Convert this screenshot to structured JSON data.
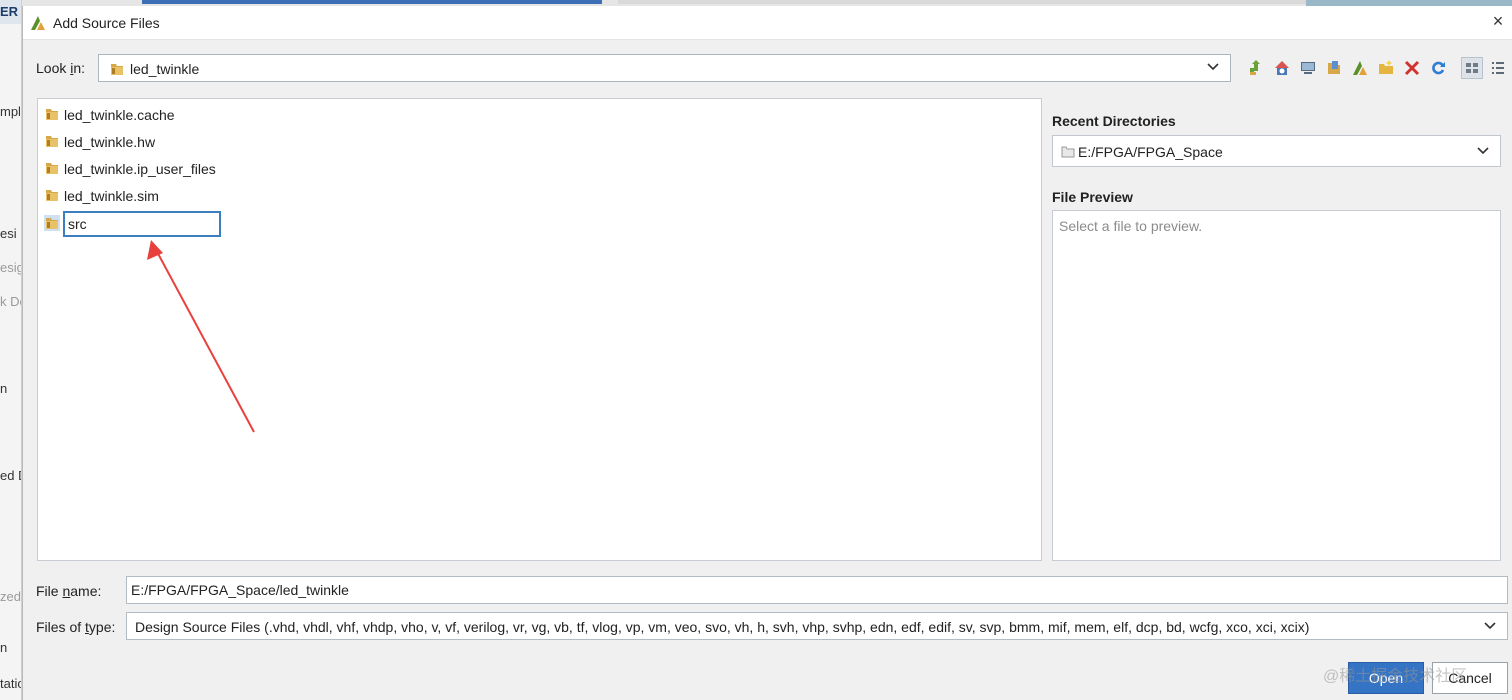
{
  "background_app": {
    "fragments": [
      "ER",
      "mpla",
      "esi",
      "esig",
      "k De",
      "n",
      "ed D",
      "zed",
      "n",
      "tatio"
    ]
  },
  "dialog": {
    "title": "Add Source Files",
    "close_glyph": "×"
  },
  "look_in": {
    "label": "Look in:",
    "value": "led_twinkle"
  },
  "toolbar": {
    "icons": [
      "up-folder-icon",
      "home-icon",
      "desktop-icon",
      "documents-icon",
      "vivado-project-icon",
      "new-folder-icon",
      "delete-icon",
      "refresh-icon",
      "list-view-icon",
      "details-view-icon"
    ]
  },
  "files": [
    {
      "name": "led_twinkle.cache"
    },
    {
      "name": "led_twinkle.hw"
    },
    {
      "name": "led_twinkle.ip_user_files"
    },
    {
      "name": "led_twinkle.sim"
    }
  ],
  "rename": {
    "value": "src"
  },
  "recent_directories": {
    "label": "Recent Directories",
    "value": "E:/FPGA/FPGA_Space"
  },
  "file_preview": {
    "label": "File Preview",
    "placeholder": "Select a file to preview."
  },
  "file_name": {
    "label": "File name:",
    "value": "E:/FPGA/FPGA_Space/led_twinkle"
  },
  "files_of_type": {
    "label": "Files of type:",
    "value": "Design Source Files (.vhd, vhdl, vhf, vhdp, vho, v, vf, verilog, vr, vg, vb, tf, vlog, vp, vm, veo, svo, vh, h, svh, vhp, svhp, edn, edf, edif, sv, svp, bmm, mif, mem, elf, dcp, bd, wcfg, xco, xci, xcix)"
  },
  "buttons": {
    "open": "Open",
    "cancel": "Cancel"
  },
  "watermark": "@稀土掘金技术社区",
  "colors": {
    "accent": "#3573c4",
    "annotation_arrow": "#e8413d",
    "folder": "#d6a84a"
  }
}
